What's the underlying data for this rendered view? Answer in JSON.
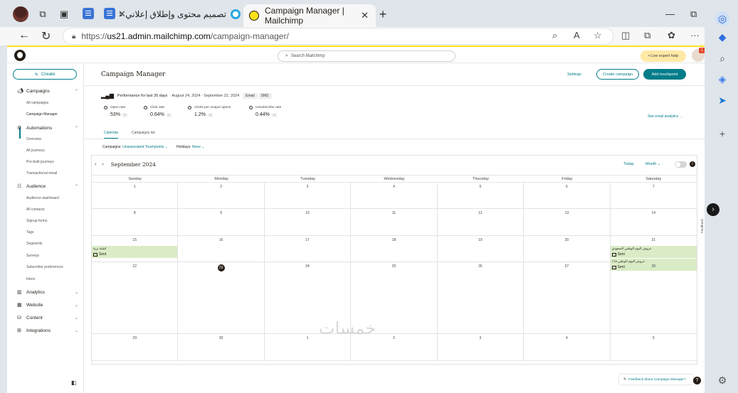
{
  "browser": {
    "tabs": [
      {
        "title": "تصميم محتوى وإطلاق إعلاني على"
      },
      {
        "title": "Campaign Manager | Mailchimp"
      }
    ],
    "new_tab": "+",
    "url_prefix": "https://",
    "url_domain": "us21.admin.mailchimp.com",
    "url_path": "/campaign-manager/"
  },
  "header": {
    "search_placeholder": "Search Mailchimp",
    "live_help": "• Live expert help",
    "notif_count": "1"
  },
  "nav": {
    "create": "Create",
    "sections": [
      {
        "label": "Campaigns",
        "icon": "megaphone-icon"
      },
      {
        "label": "Automations",
        "icon": "automation-icon"
      },
      {
        "label": "Audience",
        "icon": "audience-icon"
      },
      {
        "label": "Analytics",
        "icon": "chart-icon"
      },
      {
        "label": "Website",
        "icon": "website-icon"
      },
      {
        "label": "Content",
        "icon": "content-icon"
      },
      {
        "label": "Integrations",
        "icon": "grid-icon"
      }
    ],
    "campaigns_sub": [
      "All campaigns",
      "Campaign Manager"
    ],
    "automations_sub": [
      "Overview",
      "All journeys",
      "Pre-built journeys",
      "Transactional email"
    ],
    "audience_sub": [
      "Audience dashboard",
      "All contacts",
      "Signup forms",
      "Tags",
      "Segments",
      "Surveys",
      "Subscriber preferences",
      "Inbox"
    ]
  },
  "main": {
    "title": "Campaign Manager",
    "settings": "Settings",
    "create_campaign": "Create campaign",
    "add_touchpoint": "Add touchpoint",
    "perf_label": "Performance for last 30 days",
    "perf_dates": "· August 24, 2024 - September 22, 2024",
    "chip_email": "Email",
    "chip_sms": "SMS",
    "metrics": [
      {
        "label": "Open rate",
        "value": "53%"
      },
      {
        "label": "Click rate",
        "value": "0.64%"
      },
      {
        "label": "Clicks per unique opens",
        "value": "1.2%"
      },
      {
        "label": "Unsubscribe rate",
        "value": "0.44%"
      }
    ],
    "metric_dash": "–",
    "see_analytics": "See email analytics →",
    "tabs": [
      "Calendar",
      "Campaigns list"
    ],
    "filter_campaigns_label": "Campaigns:",
    "filter_campaigns_value": "Unassociated Touchpoints ⌄",
    "filter_holidays_label": "Holidays:",
    "filter_holidays_value": "None ⌄"
  },
  "calendar": {
    "month": "September 2024",
    "today": "Today",
    "view": "Month ⌄",
    "info": "i",
    "days_of_week": [
      "Sunday",
      "Monday",
      "Tuesday",
      "Wednesday",
      "Thursday",
      "Friday",
      "Saturday"
    ],
    "weeks": [
      [
        "1",
        "2",
        "3",
        "4",
        "5",
        "6",
        "7"
      ],
      [
        "8",
        "9",
        "10",
        "11",
        "12",
        "13",
        "14"
      ],
      [
        "15",
        "16",
        "17",
        "18",
        "19",
        "20",
        "21"
      ],
      [
        "22",
        "23",
        "24",
        "25",
        "26",
        "27",
        "28"
      ],
      [
        "29",
        "30",
        "1",
        "2",
        "3",
        "4",
        "5"
      ]
    ],
    "today_date": "23",
    "events": [
      {
        "day": "15",
        "title": "كشتة برية",
        "status": "Sent"
      },
      {
        "day": "21",
        "title": "عروض اليوم الوطني السعودي",
        "status": "Sent"
      },
      {
        "day": "21",
        "title": "عروض اليوم الوطني ١٥٪",
        "status": "Sent"
      }
    ]
  },
  "footer": {
    "feedback": "Feedback about Campaign Manager?",
    "help": "?",
    "feedback_tab": "Feedback",
    "watermark": "خمسات"
  },
  "colors": {
    "accent": "#007c89",
    "brand": "#ffe01b",
    "event": "#d9ecc6"
  }
}
